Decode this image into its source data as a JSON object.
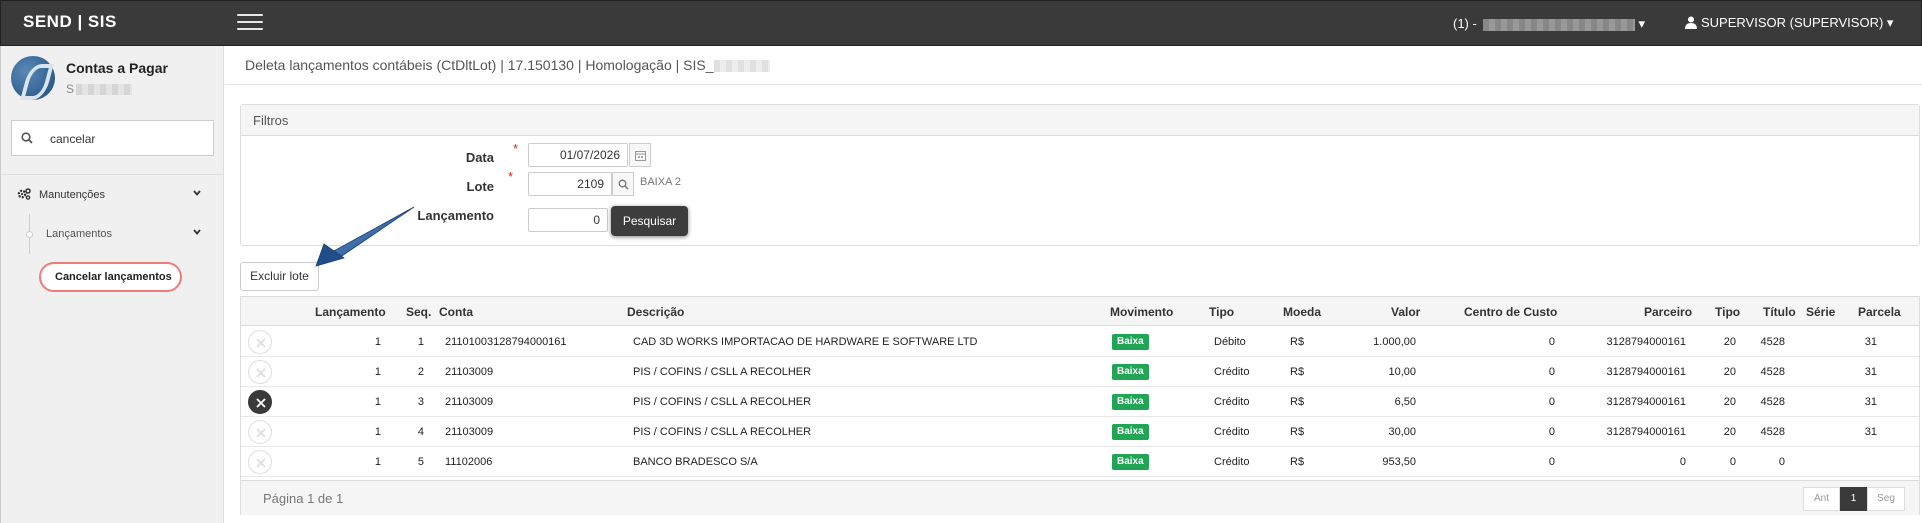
{
  "topbar": {
    "brand": "SEND | SIS",
    "company_prefix": "(1) -",
    "user": "SUPERVISOR (SUPERVISOR)"
  },
  "sidebar": {
    "module_title": "Contas a Pagar",
    "module_sub": "S",
    "search_value": "cancelar",
    "menu_manutencoes": "Manutenções",
    "menu_lancamentos": "Lançamentos",
    "menu_cancelar": "Cancelar lançamentos"
  },
  "page": {
    "title": "Deleta lançamentos contábeis (CtDltLot) | 17.150130 | Homologação | SIS_"
  },
  "filters": {
    "heading": "Filtros",
    "data_label": "Data",
    "data_value": "01/07/2026",
    "lote_label": "Lote",
    "lote_value": "2109",
    "lote_desc": "BAIXA 2",
    "lancamento_label": "Lançamento",
    "lancamento_value": "0",
    "search_button": "Pesquisar"
  },
  "actions": {
    "delete_batch": "Excluir lote"
  },
  "table": {
    "headers": {
      "lancamento": "Lançamento",
      "seq": "Seq.",
      "conta": "Conta",
      "descricao": "Descrição",
      "movimento": "Movimento",
      "tipo": "Tipo",
      "moeda": "Moeda",
      "valor": "Valor",
      "centro": "Centro de Custo",
      "parceiro": "Parceiro",
      "tipo2": "Tipo",
      "titulo": "Título",
      "serie": "Série",
      "parcela": "Parcela"
    },
    "rows": [
      {
        "lancamento": "1",
        "seq": "1",
        "conta": "21101003128794000161",
        "descricao": "CAD 3D WORKS IMPORTACAO DE HARDWARE E SOFTWARE LTD",
        "movimento": "Baixa",
        "tipo": "Débito",
        "moeda": "R$",
        "valor": "1.000,00",
        "centro": "0",
        "parceiro": "3128794000161",
        "tipo2": "20",
        "titulo": "4528",
        "serie": "",
        "parcela": "31"
      },
      {
        "lancamento": "1",
        "seq": "2",
        "conta": "21103009",
        "descricao": "PIS / COFINS / CSLL A RECOLHER",
        "movimento": "Baixa",
        "tipo": "Crédito",
        "moeda": "R$",
        "valor": "10,00",
        "centro": "0",
        "parceiro": "3128794000161",
        "tipo2": "20",
        "titulo": "4528",
        "serie": "",
        "parcela": "31"
      },
      {
        "lancamento": "1",
        "seq": "3",
        "conta": "21103009",
        "descricao": "PIS / COFINS / CSLL A RECOLHER",
        "movimento": "Baixa",
        "tipo": "Crédito",
        "moeda": "R$",
        "valor": "6,50",
        "centro": "0",
        "parceiro": "3128794000161",
        "tipo2": "20",
        "titulo": "4528",
        "serie": "",
        "parcela": "31"
      },
      {
        "lancamento": "1",
        "seq": "4",
        "conta": "21103009",
        "descricao": "PIS / COFINS / CSLL A RECOLHER",
        "movimento": "Baixa",
        "tipo": "Crédito",
        "moeda": "R$",
        "valor": "30,00",
        "centro": "0",
        "parceiro": "3128794000161",
        "tipo2": "20",
        "titulo": "4528",
        "serie": "",
        "parcela": "31"
      },
      {
        "lancamento": "1",
        "seq": "5",
        "conta": "11102006",
        "descricao": "BANCO BRADESCO S/A",
        "movimento": "Baixa",
        "tipo": "Crédito",
        "moeda": "R$",
        "valor": "953,50",
        "centro": "0",
        "parceiro": "0",
        "tipo2": "0",
        "titulo": "0",
        "serie": "",
        "parcela": ""
      }
    ]
  },
  "pagination": {
    "info": "Página 1 de 1",
    "prev": "Ant",
    "current": "1",
    "next": "Seg"
  },
  "colors": {
    "topbar": "#3a3a3a",
    "badge_green": "#1fa554",
    "highlight_red": "#f07b7b",
    "arrow_blue": "#1f4e8a"
  }
}
